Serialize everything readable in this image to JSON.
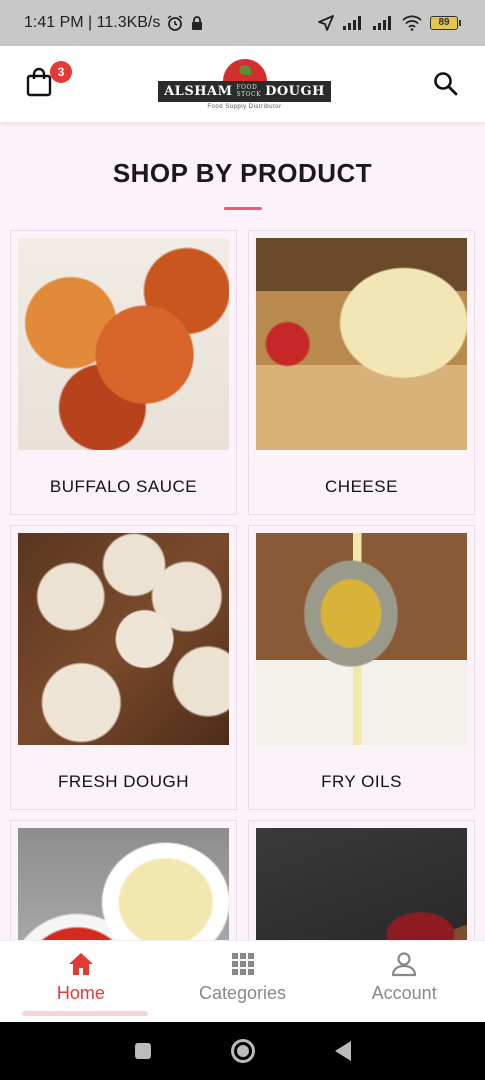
{
  "status_bar": {
    "time_speed": "1:41 PM | 11.3KB/s",
    "battery": "89",
    "icons": [
      "alarm-icon",
      "lock-icon",
      "location-icon",
      "signal-icon",
      "signal-icon",
      "wifi-icon",
      "battery-icon"
    ]
  },
  "header": {
    "cart_badge": "3",
    "logo_left": "ALSHAM",
    "logo_mid": "FOOD STOCK",
    "logo_right": "DOUGH",
    "logo_sub": "Food Supply Distributor"
  },
  "section": {
    "title": "SHOP BY PRODUCT",
    "accent_color": "#e0607e"
  },
  "products": [
    {
      "label": "BUFFALO SAUCE",
      "image": "buffalo-wings"
    },
    {
      "label": "CHEESE",
      "image": "cheese-pizza"
    },
    {
      "label": "FRESH DOUGH",
      "image": "dough-balls"
    },
    {
      "label": "FRY OILS",
      "image": "oil-pour"
    },
    {
      "label": "",
      "image": "sauces"
    },
    {
      "label": "",
      "image": "raw-meat"
    }
  ],
  "bottom_nav": {
    "items": [
      {
        "label": "Home",
        "icon": "home-icon",
        "active": true
      },
      {
        "label": "Categories",
        "icon": "grid-icon",
        "active": false
      },
      {
        "label": "Account",
        "icon": "person-icon",
        "active": false
      }
    ],
    "active_color": "#e53935"
  }
}
